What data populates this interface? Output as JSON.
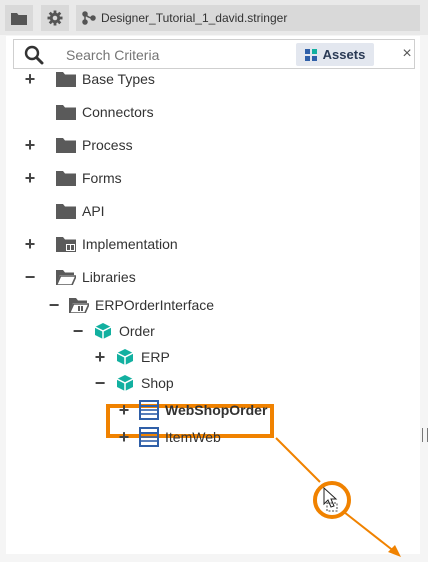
{
  "toolbar": {
    "tab_label": "Designer_Tutorial_1_david.stringer"
  },
  "search": {
    "placeholder": "Search Criteria",
    "assets_label": "Assets",
    "clear_glyph": "×"
  },
  "tree": {
    "expand_glyph": "+",
    "collapse_glyph": "−",
    "items": [
      {
        "label": "Base Types",
        "icon": "folder-icon",
        "expander": "expand"
      },
      {
        "label": "Connectors",
        "icon": "folder-icon",
        "expander": "none"
      },
      {
        "label": "Process",
        "icon": "folder-icon",
        "expander": "expand"
      },
      {
        "label": "Forms",
        "icon": "folder-icon",
        "expander": "expand"
      },
      {
        "label": "API",
        "icon": "folder-icon",
        "expander": "none"
      },
      {
        "label": "Implementation",
        "icon": "folder-implementation-icon",
        "expander": "expand"
      },
      {
        "label": "Libraries",
        "icon": "folder-open-icon",
        "expander": "collapse"
      },
      {
        "label": "ERPOrderInterface",
        "icon": "library-folder-icon",
        "expander": "collapse"
      },
      {
        "label": "Order",
        "icon": "package-icon",
        "expander": "collapse"
      },
      {
        "label": "ERP",
        "icon": "package-icon",
        "expander": "expand"
      },
      {
        "label": "Shop",
        "icon": "package-icon",
        "expander": "collapse"
      },
      {
        "label": "WebShopOrder",
        "icon": "business-object-icon",
        "expander": "expand",
        "selected": true
      },
      {
        "label": "ItemWeb",
        "icon": "business-object-icon",
        "expander": "expand"
      }
    ]
  },
  "colors": {
    "accent": "#f08200",
    "folder": "#5a5a5a",
    "package": "#12b0a0",
    "business_object": "#2f5fa8"
  }
}
